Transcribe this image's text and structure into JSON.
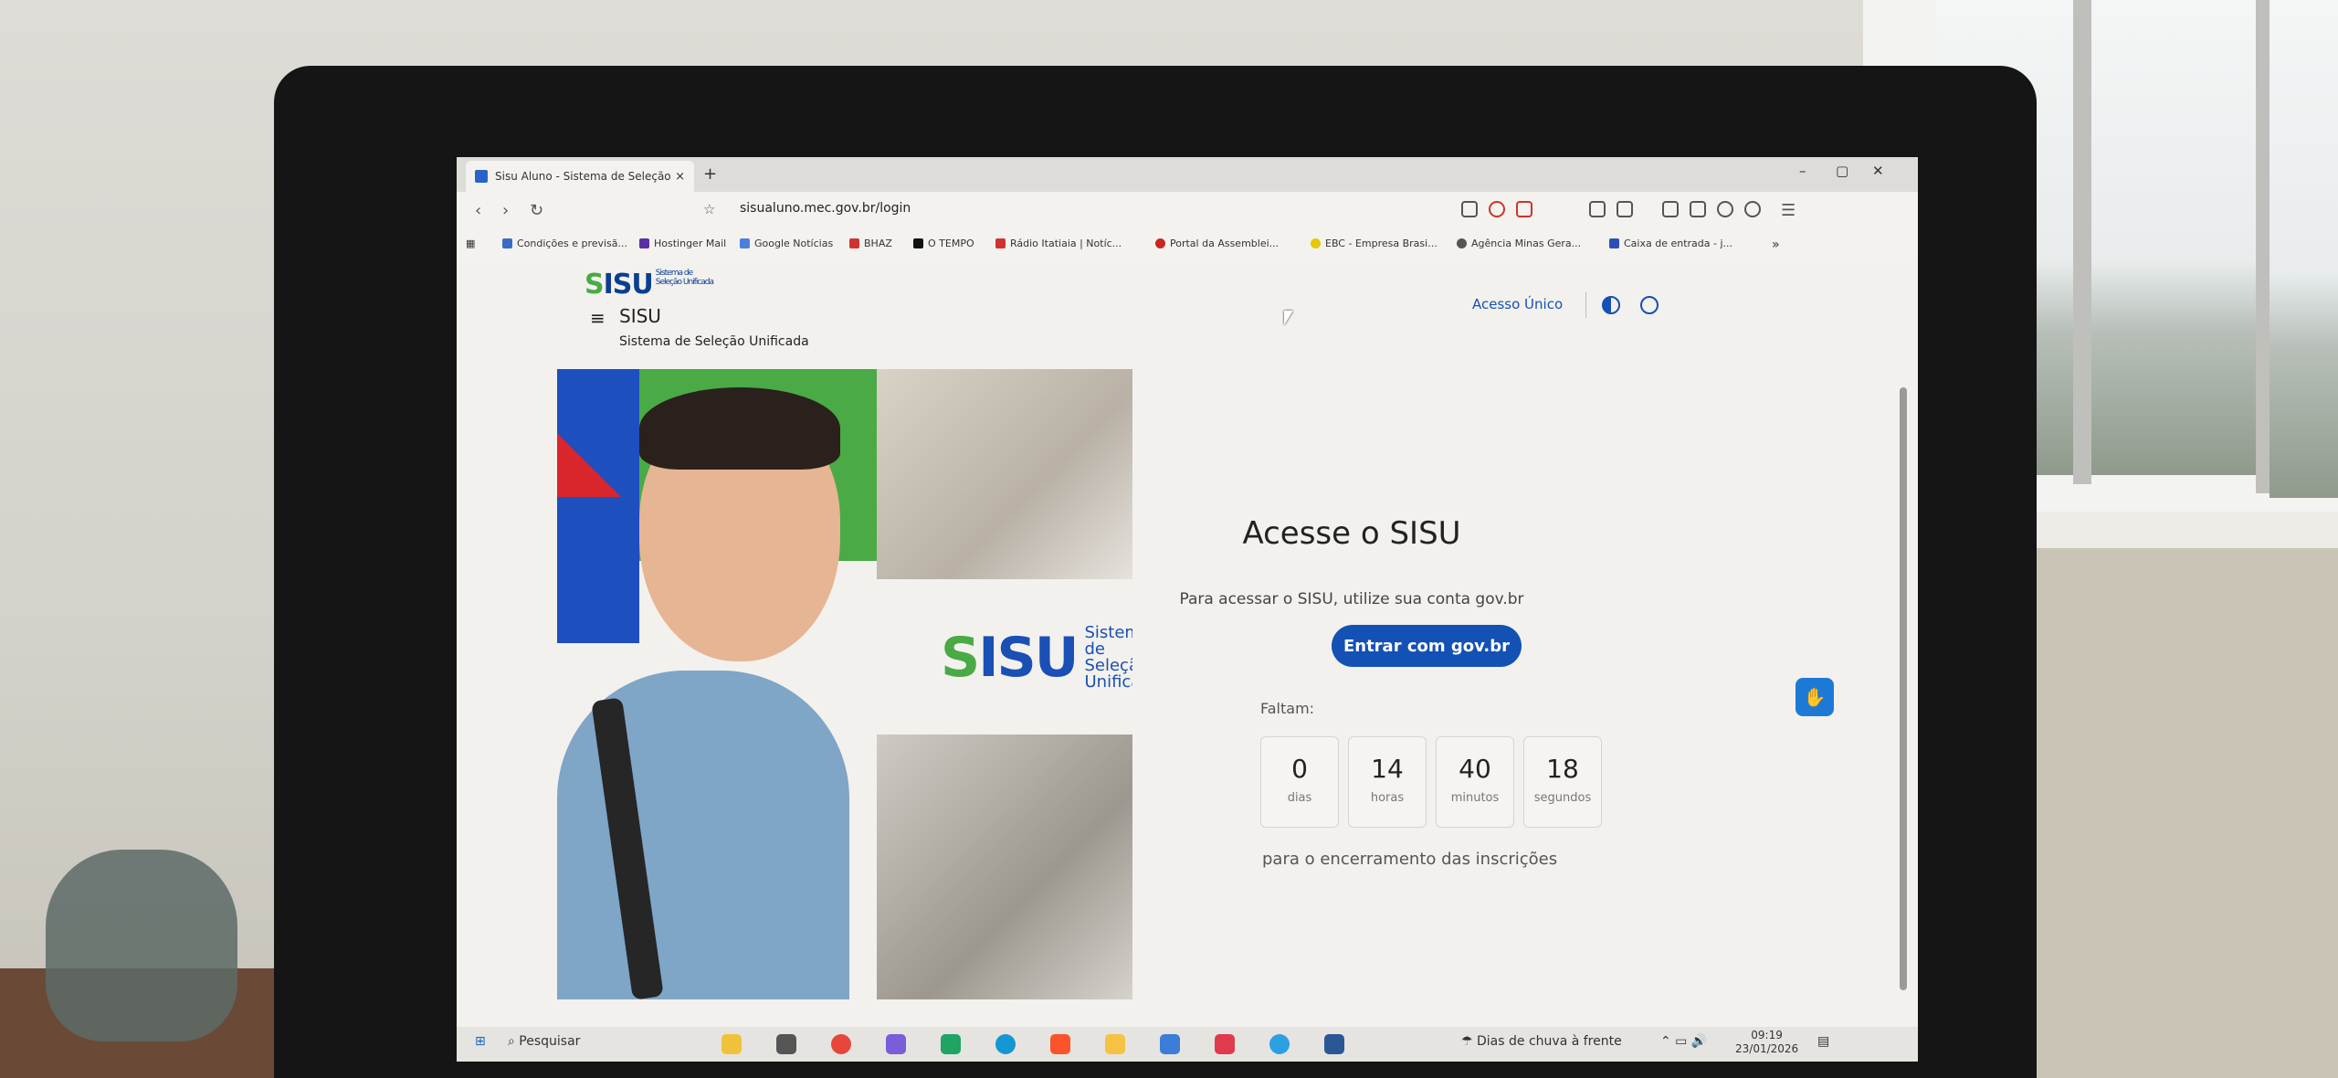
{
  "browser": {
    "tab_title": "Sisu Aluno - Sistema de Seleção",
    "tab_close": "×",
    "new_tab": "+",
    "window_controls": [
      "–",
      "▢",
      "✕"
    ],
    "nav": {
      "back": "‹",
      "forward": "›",
      "reload": "↻"
    },
    "url": "sisualuno.mec.gov.br/login",
    "bookmarks": [
      {
        "label": "Condições e previsã...",
        "color": "#3b6bc4"
      },
      {
        "label": "Hostinger Mail",
        "color": "#5b2ea6"
      },
      {
        "label": "Google Notícias",
        "color": "#4a7fe0"
      },
      {
        "label": "BHAZ",
        "color": "#d0332d"
      },
      {
        "label": "O TEMPO",
        "color": "#111111"
      },
      {
        "label": "Rádio Itatiaia | Notíc...",
        "color": "#d0332d"
      },
      {
        "label": "Portal da Assemblei...",
        "color": "#c8261f"
      },
      {
        "label": "EBC - Empresa Brasi...",
        "color": "#e6c700"
      },
      {
        "label": "Agência Minas Gera...",
        "color": "#555555"
      },
      {
        "label": "Caixa de entrada - j...",
        "color": "#2c4fb5"
      }
    ],
    "bookmarks_more": "»"
  },
  "header": {
    "logo": "ISU",
    "logo_tagline": "Sistema de Seleção Unificada",
    "menu_icon": "≡",
    "site_name": "SISU",
    "site_subtitle": "Sistema de Seleção Unificada",
    "acesso_unico": "Acesso Único"
  },
  "hero": {
    "logo": "ISU",
    "logo_text_1": "Sistema de",
    "logo_text_2": "Seleção",
    "logo_text_3": "Unificada"
  },
  "login": {
    "title": "Acesse o SISU",
    "subtitle": "Para acessar o SISU, utilize sua conta gov.br",
    "button": "Entrar com gov.br",
    "faltam": "Faltam:",
    "countdown": [
      {
        "value": "0",
        "unit": "dias"
      },
      {
        "value": "14",
        "unit": "horas"
      },
      {
        "value": "40",
        "unit": "minutos"
      },
      {
        "value": "18",
        "unit": "segundos"
      }
    ],
    "closing_text": "para o encerramento das inscrições"
  },
  "taskbar": {
    "search": "Pesquisar",
    "weather": "Dias de chuva à frente",
    "time": "09:19",
    "date": "23/01/2026"
  },
  "colors": {
    "gov_blue": "#1351b4",
    "accent_green": "#4aaa45",
    "accent_red": "#d8262b"
  }
}
